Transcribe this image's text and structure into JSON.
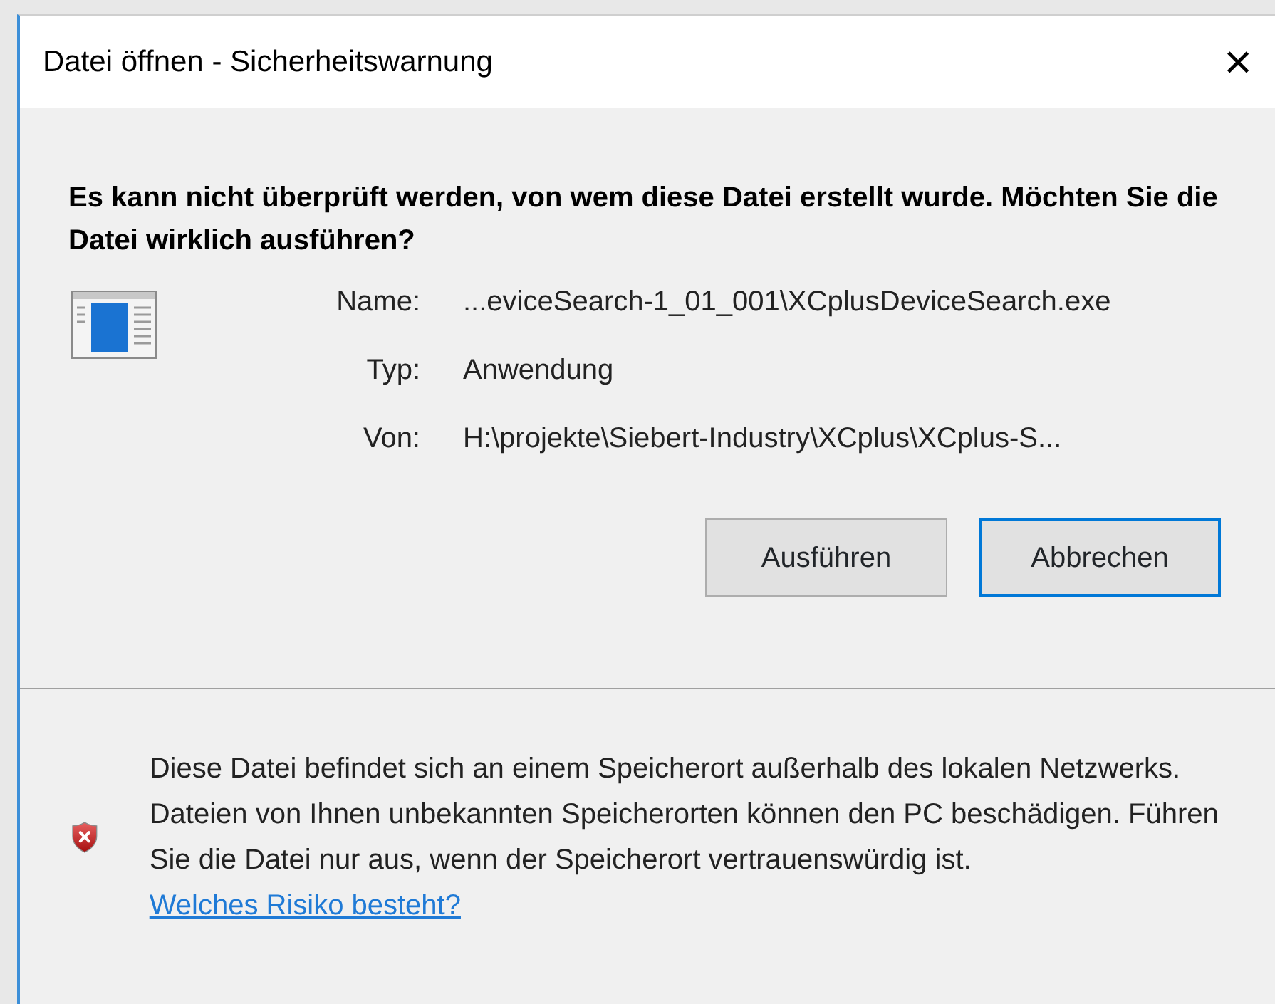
{
  "window": {
    "title": "Datei öffnen - Sicherheitswarnung",
    "close": "×"
  },
  "heading": "Es kann nicht überprüft werden, von wem diese Datei erstellt wurde. Möchten Sie die Datei wirklich ausführen?",
  "details": [
    {
      "label": "Name:",
      "value": "...eviceSearch-1_01_001\\XCplusDeviceSearch.exe"
    },
    {
      "label": "Typ:",
      "value": "Anwendung"
    },
    {
      "label": "Von:",
      "value": "H:\\projekte\\Siebert-Industry\\XCplus\\XCplus-S..."
    }
  ],
  "buttons": [
    {
      "label": "Ausführen",
      "default": false
    },
    {
      "label": "Abbrechen",
      "default": true
    }
  ],
  "warning": {
    "text": "Diese Datei befindet sich an einem Speicherort außerhalb des lokalen Netzwerks. Dateien von Ihnen unbekannten Speicherorten können den PC beschädigen. Führen Sie die Datei nur aus, wenn der Speicherort vertrauenswürdig ist.",
    "link": "Welches Risiko besteht?"
  }
}
